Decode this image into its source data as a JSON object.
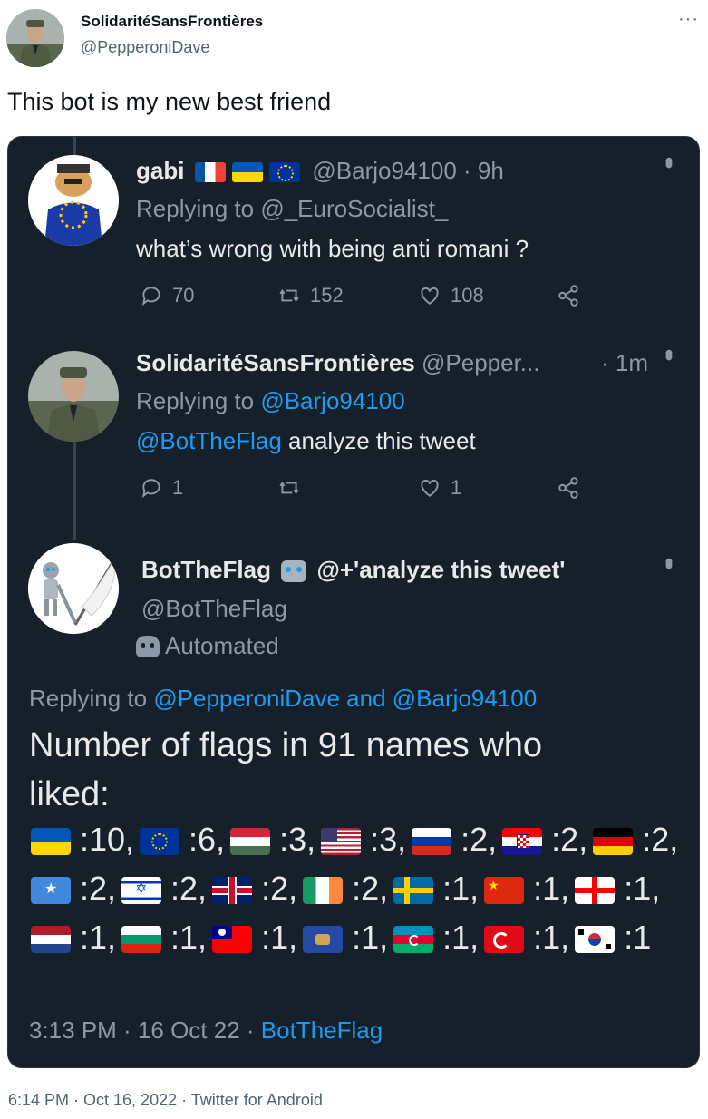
{
  "outer": {
    "name": "SolidaritéSansFrontières",
    "handle": "@PepperoniDave",
    "more": "···",
    "text": "This bot is my new best friend",
    "footer": "6:14 PM · Oct 16, 2022 · Twitter for Android"
  },
  "tweet1": {
    "name": "gabi",
    "handle": "@Barjo94100 · 9h",
    "replying_prefix": "Replying to ",
    "replying_to": "@_EuroSocialist_",
    "text": "what’s wrong with being anti romani ?",
    "replies": "70",
    "retweets": "152",
    "likes": "108"
  },
  "tweet2": {
    "name": "SolidaritéSansFrontières",
    "handle": "@Pepper...",
    "time": "· 1m",
    "replying_prefix": "Replying to ",
    "replying_to": "@Barjo94100",
    "mention": "@BotTheFlag",
    "text": " analyze this tweet",
    "replies": "1",
    "retweets": "",
    "likes": "1"
  },
  "tweet3": {
    "name": "BotTheFlag",
    "name_suffix": "@+'analyze this tweet'",
    "handle": "@BotTheFlag",
    "automated": "Automated",
    "replying_prefix": "Replying to ",
    "replying_to1": "@PepperoniDave",
    "replying_and": " and ",
    "replying_to2": "@Barjo94100",
    "text_line1": "Number of flags in 91 names who",
    "text_line2": "liked:",
    "flag_counts": [
      {
        "flag": "ukraine",
        "count": ":10,"
      },
      {
        "flag": "eu",
        "count": ":6,"
      },
      {
        "flag": "hungary",
        "count": ":3,"
      },
      {
        "flag": "usa",
        "count": ":3,"
      },
      {
        "flag": "russia",
        "count": ":2,"
      },
      {
        "flag": "croatia",
        "count": ":2,"
      },
      {
        "flag": "germany",
        "count": ":2,"
      },
      {
        "flag": "somalia",
        "count": ":2,"
      },
      {
        "flag": "israel",
        "count": ":2,"
      },
      {
        "flag": "uk",
        "count": ":2,"
      },
      {
        "flag": "ireland",
        "count": ":2,"
      },
      {
        "flag": "sweden",
        "count": ":1,"
      },
      {
        "flag": "china",
        "count": ":1,"
      },
      {
        "flag": "georgia",
        "count": ":1,"
      },
      {
        "flag": "netherlands",
        "count": ":1,"
      },
      {
        "flag": "bulgaria",
        "count": ":1,"
      },
      {
        "flag": "taiwan",
        "count": ":1,"
      },
      {
        "flag": "kosovo",
        "count": ":1,"
      },
      {
        "flag": "azerbaijan",
        "count": ":1,"
      },
      {
        "flag": "turkey",
        "count": ":1,"
      },
      {
        "flag": "south-korea",
        "count": ":1"
      }
    ],
    "timestamp": "3:13 PM · 16 Oct 22 · ",
    "source": "BotTheFlag"
  },
  "colors": {
    "card_bg": "#15202b",
    "link_blue": "#1d9bf0",
    "gray_text": "#8b98a5",
    "white_text": "#e7e9ea"
  }
}
